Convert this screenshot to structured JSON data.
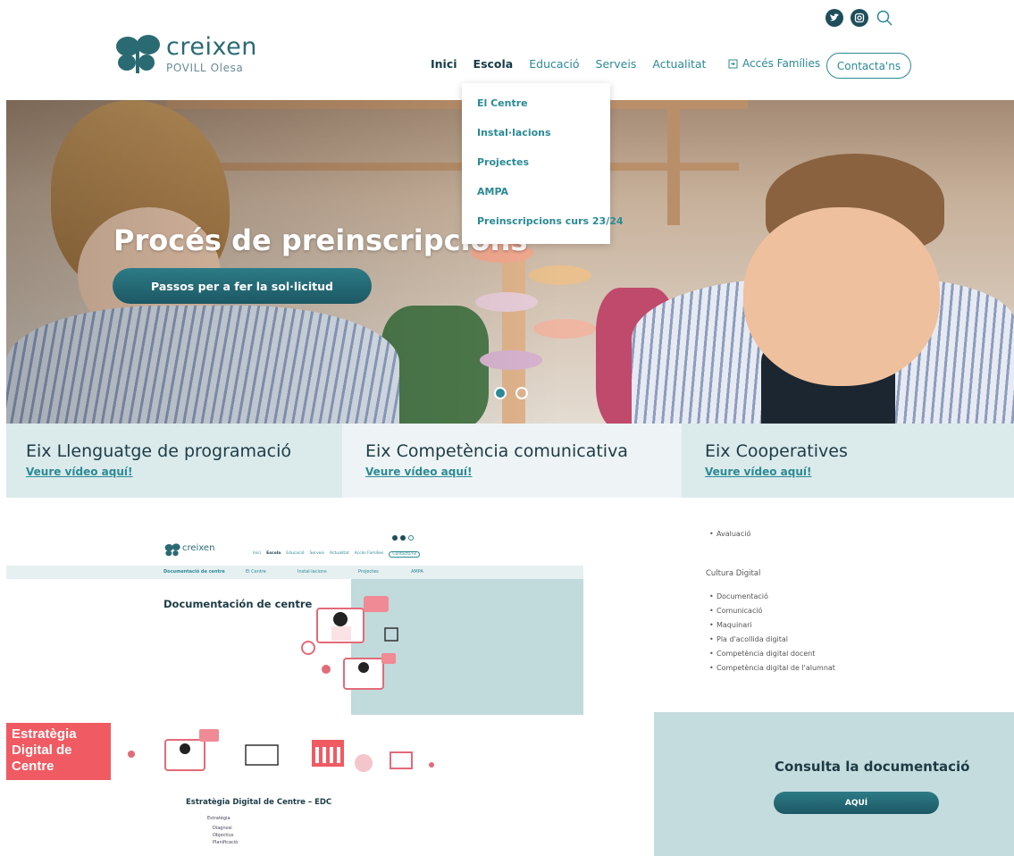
{
  "brand": {
    "name": "creixen",
    "subtitle": "POVILL Olesa"
  },
  "nav": {
    "items": [
      "Inici",
      "Escola",
      "Educació",
      "Serveis",
      "Actualitat"
    ],
    "active": "Escola",
    "acces_label": "Accés Famílies",
    "contact_label": "Contacta'ns"
  },
  "dropdown": {
    "items": [
      "El Centre",
      "Instal·lacions",
      "Projectes",
      "AMPA",
      "Preinscripcions curs 23/24"
    ]
  },
  "hero": {
    "title": "Procés de preinscripcions",
    "button_label": "Passos per a fer la sol·licitud",
    "slide_count": 2,
    "active_slide": 1
  },
  "eixos": [
    {
      "title": "Eix Llenguatge de programació",
      "link": "Veure vídeo aquí!"
    },
    {
      "title": "Eix Competència comunicativa",
      "link": "Veure vídeo aquí!"
    },
    {
      "title": "Eix Cooperatives",
      "link": "Veure vídeo aquí!"
    }
  ],
  "preview": {
    "title": "Documentación de centre",
    "mini_nav": [
      "Documentació de centre",
      "El Centre",
      "Instal·lacions",
      "Projectes",
      "AMPA"
    ]
  },
  "cultura": {
    "top_item": "Avaluació",
    "heading": "Cultura Digital",
    "items": [
      "Documentació",
      "Comunicació",
      "Maquinari",
      "Pla d'acollida digital",
      "Competència digital docent",
      "Competència digital de l'alumnat"
    ]
  },
  "edc": {
    "badge": [
      "Estratègia",
      "Digital de",
      "Centre"
    ],
    "title": "Estratègia Digital de Centre – EDC",
    "sub_heading": "Estratègia",
    "sub_items": [
      "Diagnosi",
      "Objectius",
      "Planificació"
    ]
  },
  "consulta": {
    "title": "Consulta la documentació",
    "button_label": "AQUÍ"
  },
  "colors": {
    "accent": "#2b8a95",
    "dark_teal": "#1c5864",
    "strip": "#dbeaeb",
    "badge": "#f05a62"
  }
}
